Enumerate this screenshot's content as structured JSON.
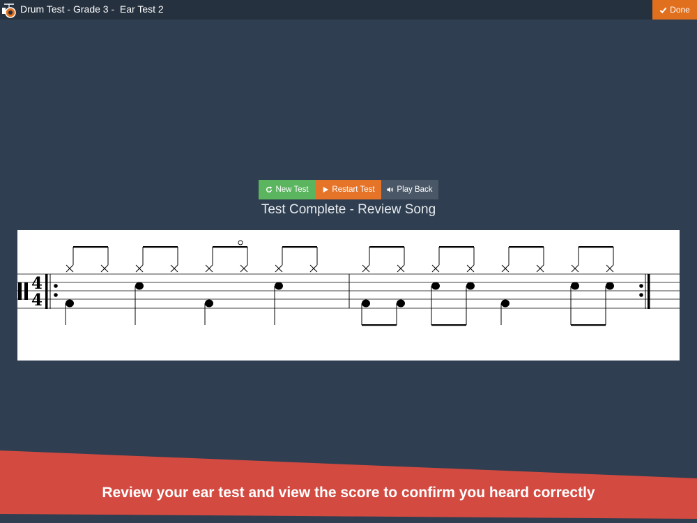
{
  "header": {
    "title": "Drum Test - Grade 3 -  Ear Test 2",
    "done_label": "Done",
    "done_icon": "check-icon",
    "logo_icon": "drum-kit-icon"
  },
  "toolbar": {
    "new_test_label": "New Test",
    "new_test_icon": "refresh-icon",
    "restart_label": "Restart Test",
    "restart_icon": "play-icon",
    "play_back_label": "Play Back",
    "play_back_icon": "speaker-icon"
  },
  "status": "Test Complete - Review Song",
  "score": {
    "time_signature": {
      "top": "4",
      "bottom": "4"
    },
    "clef": "percussion",
    "repeat_end": true,
    "measures": [
      {
        "hihat_pairs": 4,
        "open_hihat_on": [
          3
        ],
        "beats": [
          {
            "kick": true,
            "snare": false
          },
          {
            "kick": false,
            "snare": true
          },
          {
            "kick": true,
            "snare": false
          },
          {
            "kick": false,
            "snare": true
          }
        ]
      },
      {
        "hihat_pairs": 4,
        "open_hihat_on": [],
        "beats": [
          {
            "notes": [
              {
                "kick": true
              },
              {
                "kick": true
              }
            ]
          },
          {
            "notes": [
              {
                "snare": true
              },
              {
                "snare": true
              }
            ]
          },
          {
            "notes": [
              {
                "kick": true
              }
            ]
          },
          {
            "notes": [
              {
                "snare": true
              },
              {
                "snare": true
              }
            ]
          }
        ]
      }
    ]
  },
  "colors": {
    "background": "#2f3e50",
    "topbar": "#25313f",
    "done": "#e0701e",
    "new_test": "#5ab55e",
    "restart": "#e67428",
    "play_back": "#4a5766",
    "banner": "#d34a41"
  },
  "banner": {
    "text": "Review your ear test and view the score to confirm you heard correctly"
  }
}
